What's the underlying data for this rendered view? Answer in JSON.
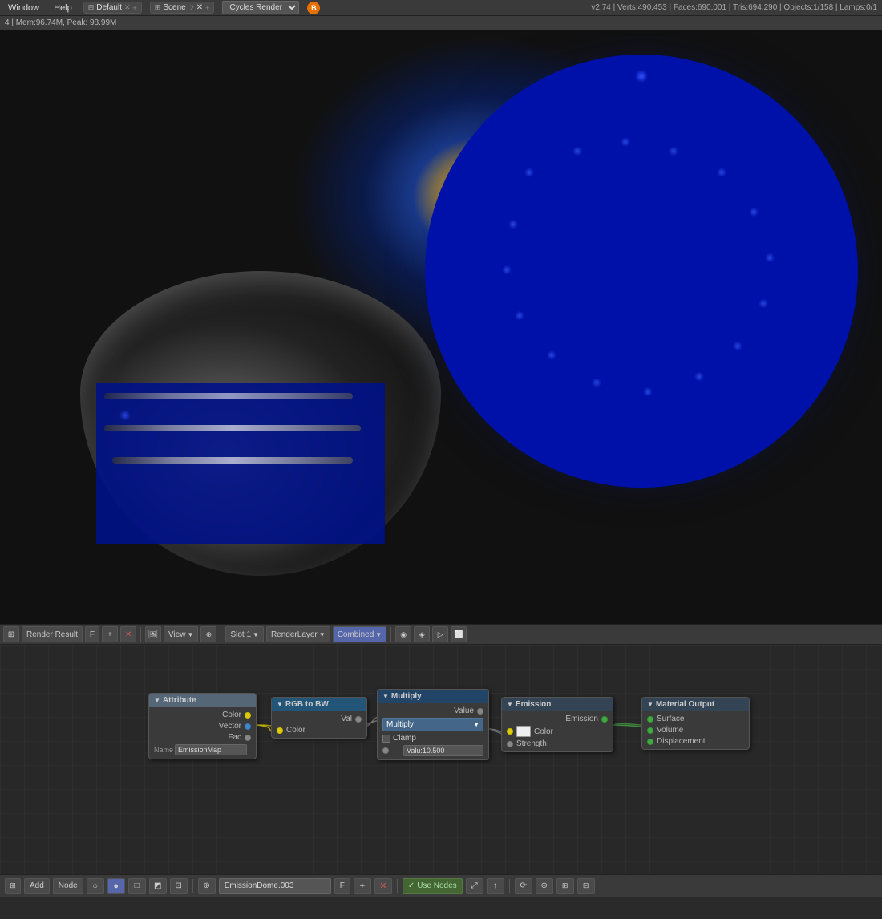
{
  "app": {
    "title": "Blender",
    "version": "v2.74"
  },
  "menu": {
    "items": [
      "Window",
      "Help"
    ]
  },
  "workspace": {
    "tab1_label": "Default",
    "tab2_label": "Scene",
    "tab2_num": "2"
  },
  "renderer": {
    "name": "Cycles Render"
  },
  "stats": {
    "verts": "Verts:490,453",
    "faces": "Faces:690,001",
    "tris": "Tris:694,290",
    "objects": "Objects:1/158",
    "lamps": "Lamps:0/1"
  },
  "memory": {
    "text": "4 | Mem:96.74M, Peak: 98.99M"
  },
  "render_toolbar": {
    "title": "Render Result",
    "f_label": "F",
    "add_btn": "+",
    "view_label": "View",
    "slot_label": "Slot 1",
    "render_layer_label": "RenderLayer",
    "combined_label": "Combined"
  },
  "nodes": {
    "attribute": {
      "header": "Attribute",
      "outputs": [
        "Color",
        "Vector",
        "Fac"
      ],
      "name_label": "Name",
      "name_value": "EmissionMap"
    },
    "rgb2bw": {
      "header": "RGB to BW",
      "outputs": [
        "Val"
      ],
      "inputs": [
        "Color"
      ]
    },
    "multiply": {
      "header": "Multiply",
      "input_label": "Value",
      "dropdown_label": "Multiply",
      "clamp_label": "Clamp",
      "value_label": "Value",
      "value": "Valu:10.500"
    },
    "emission": {
      "header": "Emission",
      "outputs": [
        "Emission"
      ],
      "inputs": [
        "Color",
        "Strength"
      ]
    },
    "output": {
      "header": "Material Output",
      "inputs": [
        "Surface",
        "Volume",
        "Displacement"
      ]
    }
  },
  "bottom_toolbar": {
    "add_label": "Add",
    "node_label": "Node",
    "material_name": "EmissionDome.003",
    "f_label": "F",
    "use_nodes_label": "Use Nodes"
  }
}
